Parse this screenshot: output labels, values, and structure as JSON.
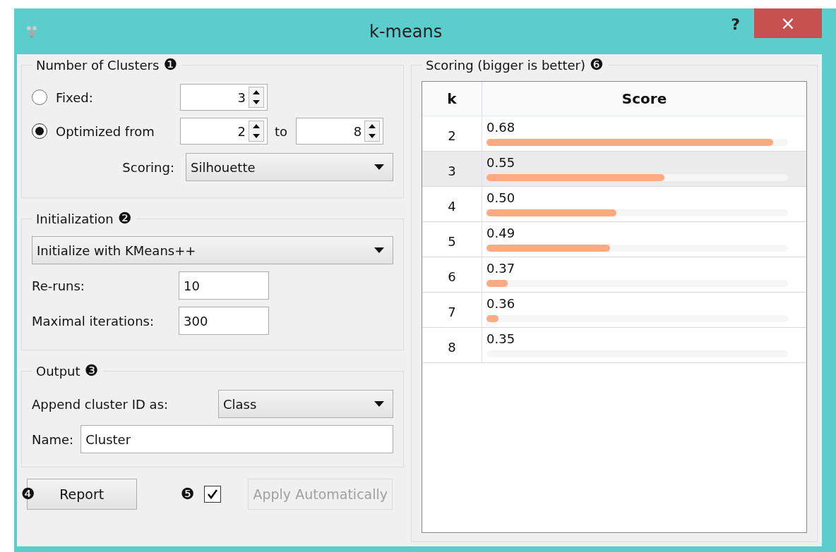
{
  "window": {
    "title": "k-means",
    "help": "?",
    "close": "×"
  },
  "number_of_clusters": {
    "title": "Number of Clusters",
    "marker": "❶",
    "options": [
      {
        "kind": "fixed",
        "label": "Fixed:",
        "selected": false,
        "value": "3"
      },
      {
        "kind": "range",
        "label": "Optimized from",
        "selected": true,
        "value": "2",
        "to_label": "to",
        "to": "8"
      }
    ],
    "scoring": {
      "label": "Scoring:",
      "value": "Silhouette"
    }
  },
  "initialization": {
    "title": "Initialization",
    "marker": "❷",
    "method": "Initialize with KMeans++",
    "reruns": {
      "label": "Re-runs:",
      "value": "10"
    },
    "max_iterations": {
      "label": "Maximal iterations:",
      "value": "300"
    }
  },
  "output": {
    "title": "Output",
    "marker": "❸",
    "append": {
      "label": "Append cluster ID as:",
      "value": "Class"
    },
    "name": {
      "label": "Name:",
      "value": "Cluster"
    }
  },
  "footer": {
    "report_marker": "❹",
    "report": "Report",
    "auto_marker": "❺",
    "auto_checked": true,
    "apply": {
      "label": "Apply Automatically",
      "disabled": true
    }
  },
  "scores": {
    "title": "Scoring (bigger is better)",
    "marker": "❻",
    "columns": [
      "k",
      "Score"
    ],
    "rows": [
      {
        "k": "2",
        "score": "0.68",
        "level": 0.95,
        "selected": false
      },
      {
        "k": "3",
        "score": "0.55",
        "level": 0.59,
        "selected": true
      },
      {
        "k": "4",
        "score": "0.50",
        "level": 0.43,
        "selected": false
      },
      {
        "k": "5",
        "score": "0.49",
        "level": 0.41,
        "selected": false
      },
      {
        "k": "6",
        "score": "0.37",
        "level": 0.07,
        "selected": false
      },
      {
        "k": "7",
        "score": "0.36",
        "level": 0.04,
        "selected": false
      },
      {
        "k": "8",
        "score": "0.35",
        "selected": false
      }
    ]
  }
}
